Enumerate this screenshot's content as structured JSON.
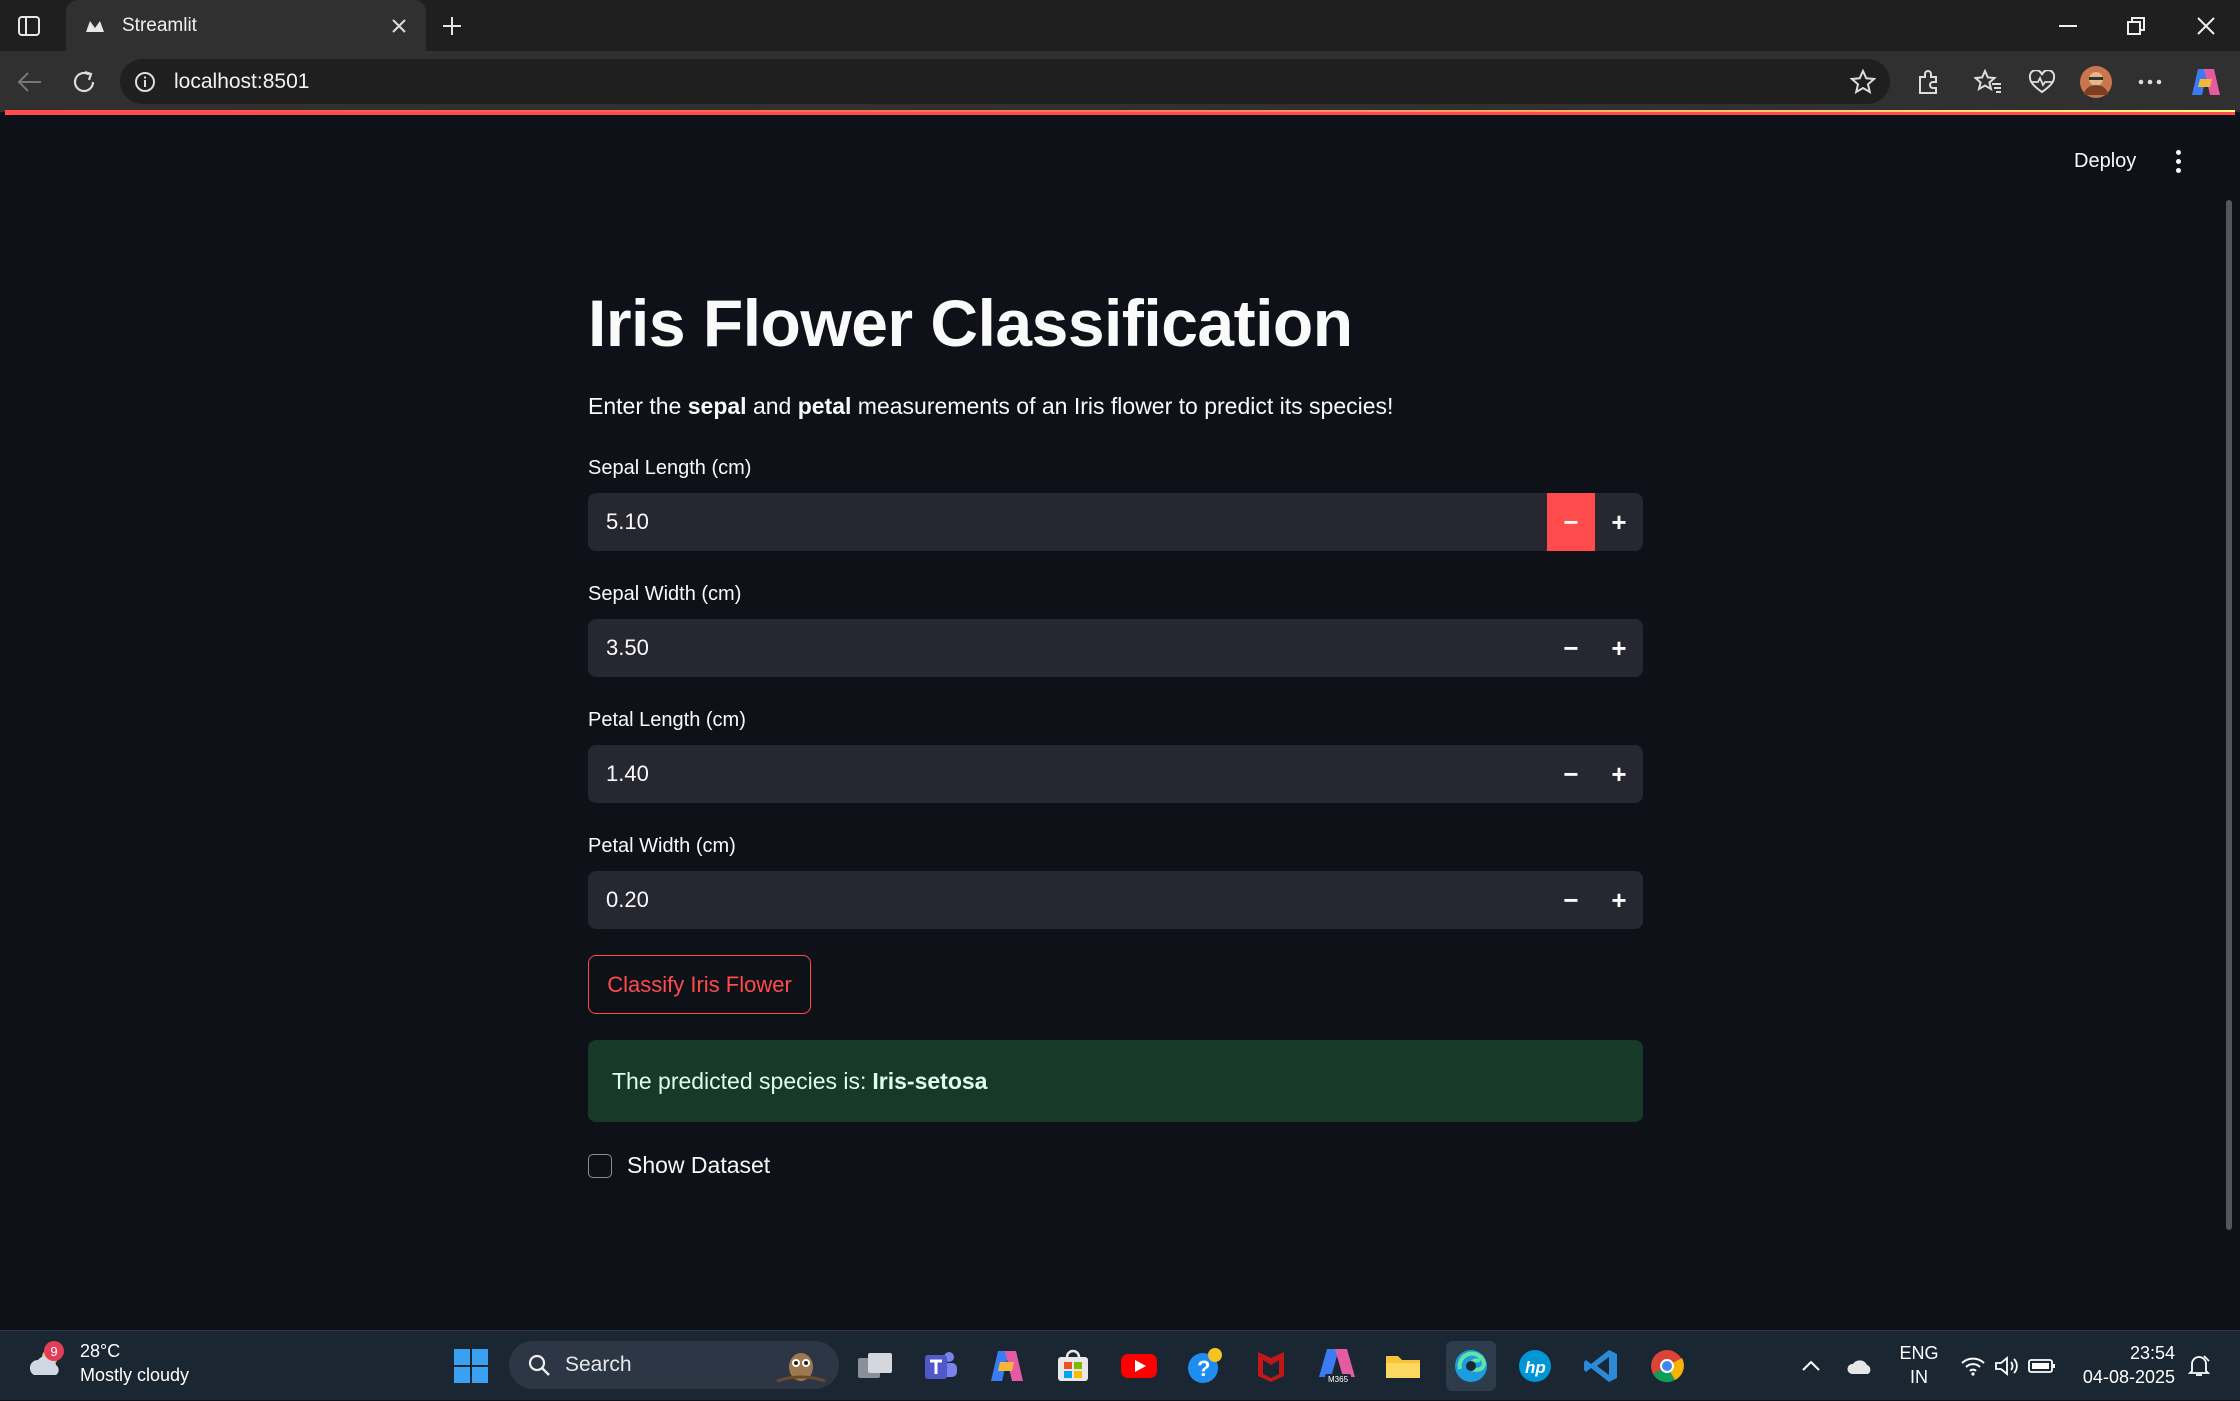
{
  "browser": {
    "tab_title": "Streamlit",
    "url": "localhost:8501"
  },
  "app": {
    "deploy_label": "Deploy",
    "title": "Iris Flower Classification",
    "intro": {
      "part1": "Enter the ",
      "bold1": "sepal",
      "part2": " and ",
      "bold2": "petal",
      "part3": " measurements of an Iris flower to predict its species!"
    },
    "inputs": [
      {
        "label": "Sepal Length (cm)",
        "value": "5.10"
      },
      {
        "label": "Sepal Width (cm)",
        "value": "3.50"
      },
      {
        "label": "Petal Length (cm)",
        "value": "1.40"
      },
      {
        "label": "Petal Width (cm)",
        "value": "0.20"
      }
    ],
    "classify_button": "Classify Iris Flower",
    "result": {
      "prefix": "The predicted species is:",
      "species": "Iris-setosa"
    },
    "show_dataset_label": "Show Dataset",
    "show_dataset_checked": false,
    "accent_color": "#ff4b4b"
  },
  "taskbar": {
    "weather_badge": "9",
    "temperature": "28°C",
    "weather_desc": "Mostly cloudy",
    "search_placeholder": "Search",
    "lang_line1": "ENG",
    "lang_line2": "IN",
    "time": "23:54",
    "date": "04-08-2025",
    "apps": [
      "file-explorer-tasks-icon",
      "teams-icon",
      "copilot-icon",
      "microsoft-store-icon",
      "youtube-icon",
      "help-icon",
      "mcafee-icon",
      "m365-icon",
      "folder-icon",
      "edge-icon",
      "hp-icon",
      "vscode-icon",
      "chrome-icon"
    ]
  }
}
